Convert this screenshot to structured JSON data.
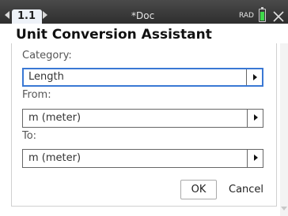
{
  "topbar": {
    "tab_label": "1.1",
    "doc_title": "*Doc",
    "angle_mode": "RAD",
    "icons": [
      "tab-left-arrow-icon",
      "tab-right-arrow-icon",
      "battery-icon",
      "close-icon"
    ],
    "battery_color": "#3fd84a"
  },
  "dialog": {
    "title": "Unit Conversion Assistant",
    "category_label": "Category:",
    "category_value": "Length",
    "from_label": "From:",
    "from_value": "m (meter)",
    "to_label": "To:",
    "to_value": "m (meter)",
    "ok_label": "OK",
    "cancel_label": "Cancel",
    "focus_color": "#3a78d4"
  }
}
